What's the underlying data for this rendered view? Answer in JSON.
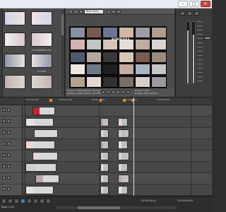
{
  "window": {
    "controls": [
      "–",
      "□",
      "✕"
    ]
  },
  "media_panel": {
    "items": [
      {
        "label": "",
        "colors": [
          "#cfd6e8",
          "#f0e1e4"
        ]
      },
      {
        "label": "includeinfo.com",
        "colors": [
          "#f2eeee",
          "#d9c8cc"
        ]
      },
      {
        "label": "In Love",
        "colors": [
          "#8e97a8",
          "#e5e1de"
        ]
      },
      {
        "label": "",
        "colors": [
          "#c3b4ac",
          "#ded6d2"
        ]
      }
    ]
  },
  "preview": {
    "toolbar_dropdown": "Best (Full)",
    "overlay_title": "BONBIDES",
    "info_left": [
      "Project: 1280x720x32, 23.976p",
      "Preview: 1280x720x32, 23.976p"
    ],
    "info_right": [
      "Frame: 1,063",
      "Display: 342x192x32"
    ],
    "tile_colors": [
      "#8a8fa6",
      "#7d5a4f",
      "#6b7794",
      "#cfb7a2",
      "#9f9da3",
      "#b19d8d",
      "#d4b2b4",
      "#c4c4c4",
      "#d6c5b8",
      "#e5ddd8",
      "#bfae9d",
      "#d9d4ce",
      "#4d5a6d",
      "#b4a89c",
      "#3a3a3a",
      "#d8c7b5",
      "#7c5b4f",
      "#9c8a7a",
      "#efe7e2",
      "#6c7a88",
      "#1f1f1f",
      "#c8a9a2",
      "#a8b5c3",
      "#c6c6c6",
      "#b4a28f",
      "#e4d7cf",
      "#323232",
      "#7a6f66",
      "#d7d0c9",
      "#9f98a0"
    ]
  },
  "mixer": {
    "meter_levels": [
      0.85,
      0.78
    ]
  },
  "timeline": {
    "ruler_labels": [
      "00:00:10;00",
      "00:00:20;00",
      "00:00:30;00",
      "00:00:40;00",
      "00:00:50;00"
    ],
    "clip_colors": [
      "#c0262d",
      "#e8e2e0",
      "#d8d8d8",
      "#ead7d3",
      "#e1d7d4",
      "#d1cfd1",
      "#bfa6a8",
      "#e1e1e1"
    ]
  },
  "status": {
    "rate": "Rate: 0.00",
    "timecode": "00:00:48;14",
    "end_timecode": "00:04:00;00"
  }
}
